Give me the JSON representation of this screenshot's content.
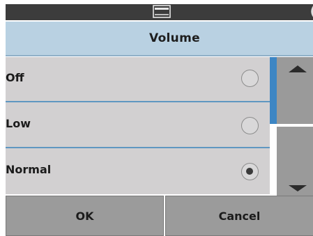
{
  "status_bar": {
    "tray_icon": "printer-tray-icon",
    "corner_glyph": "("
  },
  "header": {
    "title": "Volume"
  },
  "options": [
    {
      "label": "Off",
      "selected": false
    },
    {
      "label": "Low",
      "selected": false
    },
    {
      "label": "Normal",
      "selected": true
    }
  ],
  "scroll": {
    "up_icon": "arrow-up-icon",
    "down_icon": "arrow-down-icon"
  },
  "buttons": {
    "ok": "OK",
    "cancel": "Cancel"
  },
  "colors": {
    "accent": "#3d86c4",
    "title_bg": "#b9d1e2",
    "list_bg": "#d2d0d1",
    "button_bg": "#9b9b9b"
  }
}
